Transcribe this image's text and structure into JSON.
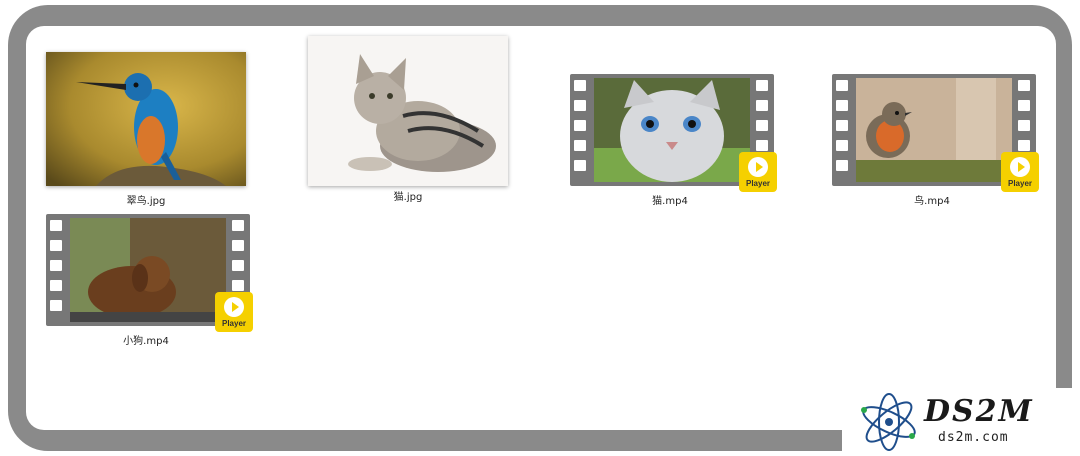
{
  "files": [
    {
      "name": "翠鸟.jpg",
      "kind": "image",
      "subject": "kingfisher"
    },
    {
      "name": "猫.jpg",
      "kind": "image",
      "subject": "kitten"
    },
    {
      "name": "猫.mp4",
      "kind": "video",
      "subject": "kitten",
      "badge": "Player"
    },
    {
      "name": "鸟.mp4",
      "kind": "video",
      "subject": "robin",
      "badge": "Player"
    },
    {
      "name": "小狗.mp4",
      "kind": "video",
      "subject": "puppy",
      "badge": "Player"
    }
  ],
  "watermark": {
    "title": "DS2M",
    "site": "ds2m.com"
  },
  "colors": {
    "frame": "#8a8a8a",
    "badge": "#f5d000",
    "film": "#777777"
  }
}
